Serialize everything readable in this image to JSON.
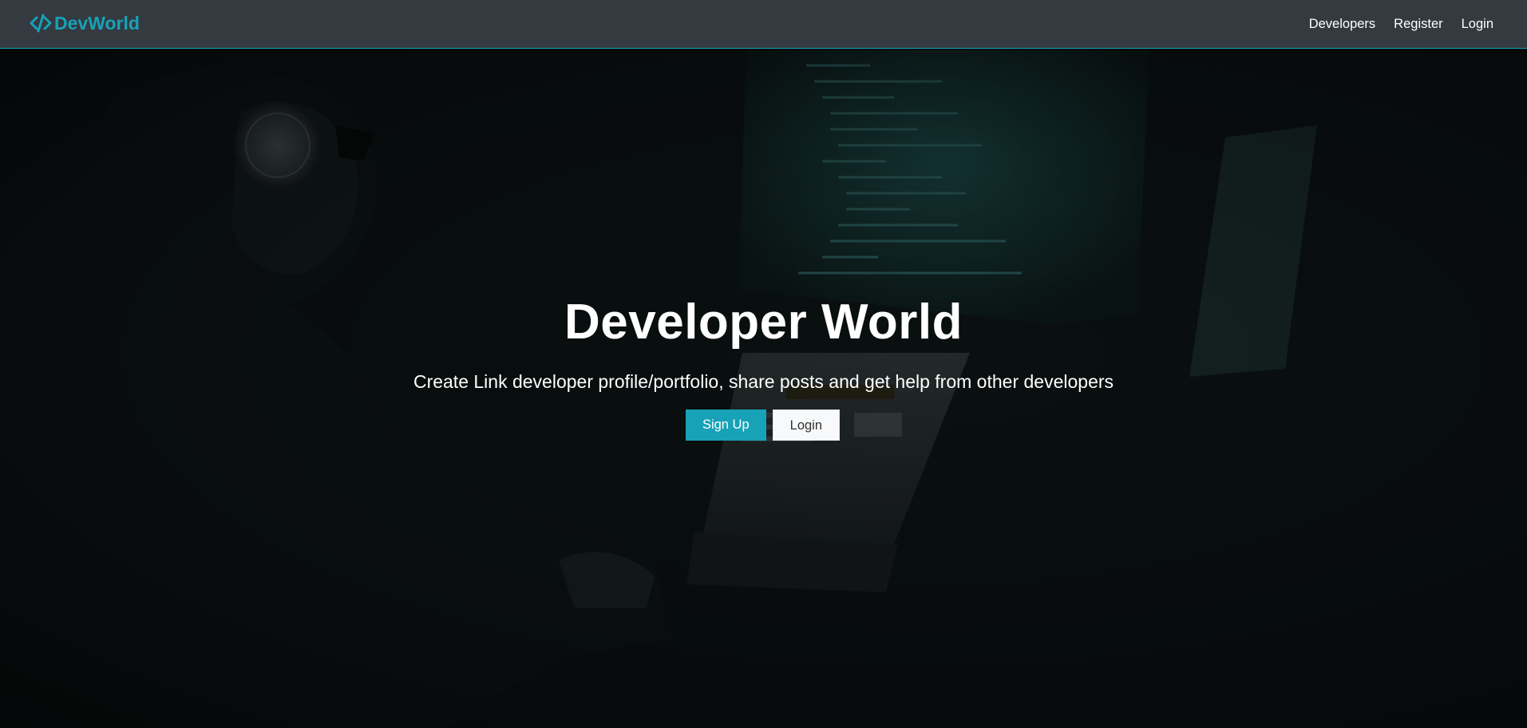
{
  "navbar": {
    "brand": "DevWorld",
    "brand_icon": "code-icon",
    "links": [
      {
        "label": "Developers"
      },
      {
        "label": "Register"
      },
      {
        "label": "Login"
      }
    ]
  },
  "hero": {
    "title": "Developer World",
    "lead": "Create Link developer profile/portfolio, share posts and get help from other developers",
    "signup_label": "Sign Up",
    "login_label": "Login",
    "background_image": "developer-at-computer-photo"
  },
  "colors": {
    "accent": "#17a2b8",
    "navbar_bg": "#343a40",
    "light_button": "#f8f9fa"
  }
}
